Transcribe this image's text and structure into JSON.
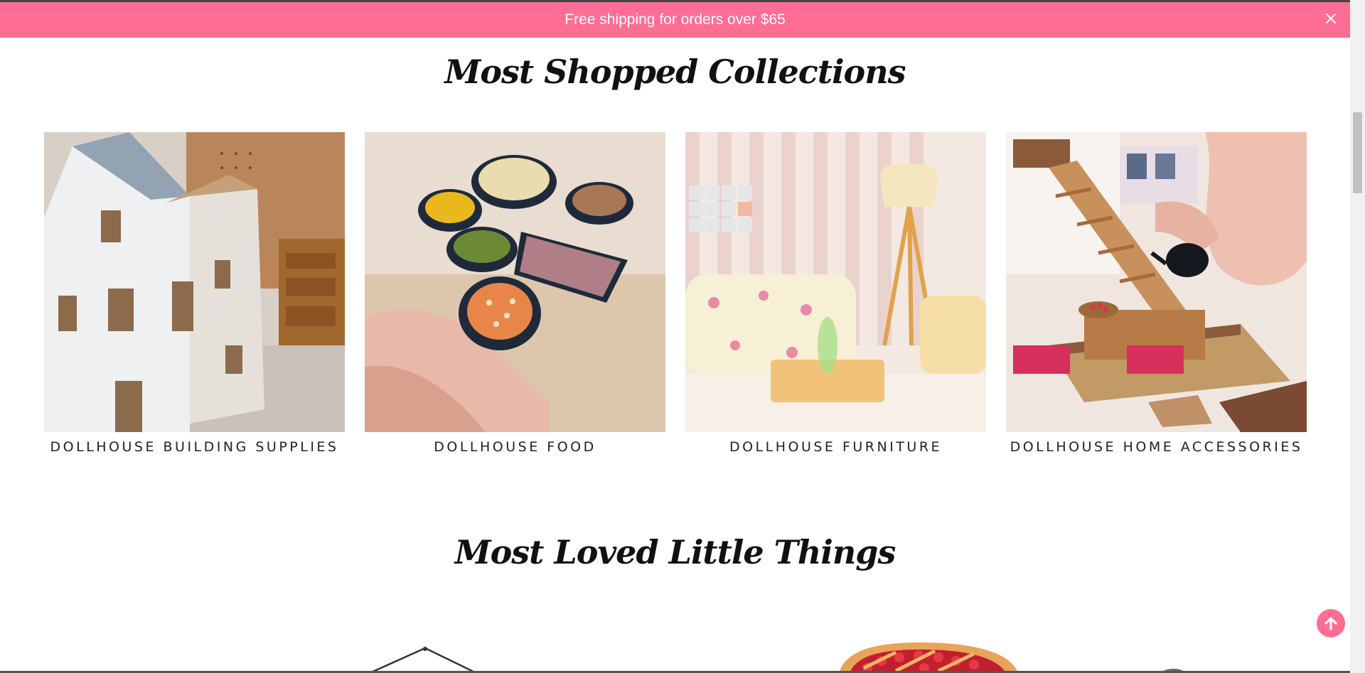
{
  "announcement": {
    "text": "Free shipping for orders over $65",
    "close_icon": "close-icon",
    "background": "#fe6d93"
  },
  "sections": {
    "collections_title": "Most Shopped Collections",
    "loved_title": "Most Loved Little Things"
  },
  "collections": [
    {
      "label": "DOLLHOUSE BUILDING SUPPLIES",
      "image": "dollhouse-building-supplies-image"
    },
    {
      "label": "DOLLHOUSE FOOD",
      "image": "dollhouse-food-image"
    },
    {
      "label": "DOLLHOUSE FURNITURE",
      "image": "dollhouse-furniture-image"
    },
    {
      "label": "DOLLHOUSE HOME ACCESSORIES",
      "image": "dollhouse-home-accessories-image"
    }
  ],
  "scroll_top": {
    "icon": "arrow-up-circle-icon",
    "color": "#fe6d93"
  }
}
